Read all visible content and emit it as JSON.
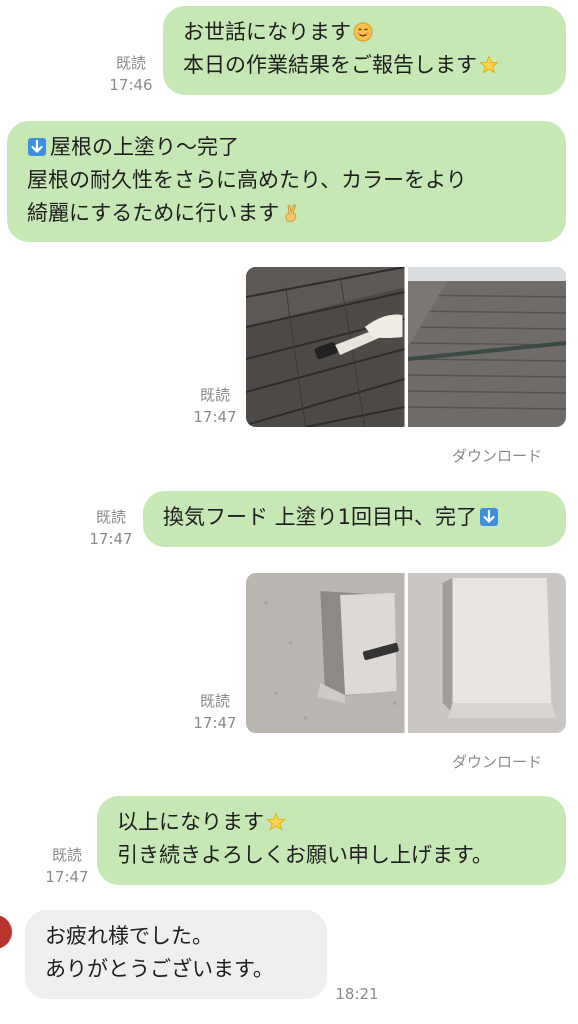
{
  "messages": {
    "m1": {
      "read": "既読",
      "time": "17:46",
      "lines": [
        "お世話になります",
        "本日の作業結果をご報告します"
      ],
      "emojis": [
        "smiling-face-icon",
        "star-icon"
      ]
    },
    "m2": {
      "lines": [
        "屋根の上塗り〜完了",
        "屋根の耐久性をさらに高めたり、カラーをより",
        "綺麗にするために行います"
      ],
      "emojis": [
        "down-arrow-icon",
        "peace-hand-icon"
      ]
    },
    "p1": {
      "read": "既読",
      "time": "17:47",
      "download": "ダウンロード",
      "photos": [
        "roof-being-painted",
        "roof-painted"
      ]
    },
    "m3": {
      "read": "既読",
      "time": "17:47",
      "lines": [
        "換気フード 上塗り1回目中、完了"
      ],
      "emojis": [
        "down-arrow-icon"
      ]
    },
    "p2": {
      "read": "既読",
      "time": "17:47",
      "download": "ダウンロード",
      "photos": [
        "vent-hood-being-painted",
        "vent-hood-painted"
      ]
    },
    "m4": {
      "read": "既読",
      "time": "17:47",
      "lines": [
        "以上になります",
        "引き続きよろしくお願い申し上げます。"
      ],
      "emojis": [
        "star-icon"
      ]
    },
    "m5": {
      "time": "18:21",
      "lines": [
        "お疲れ様でした。",
        "ありがとうございます。"
      ]
    }
  },
  "colors": {
    "outgoing": "#c6e8b4",
    "incoming": "#efefef",
    "meta": "#8a8a8a"
  }
}
